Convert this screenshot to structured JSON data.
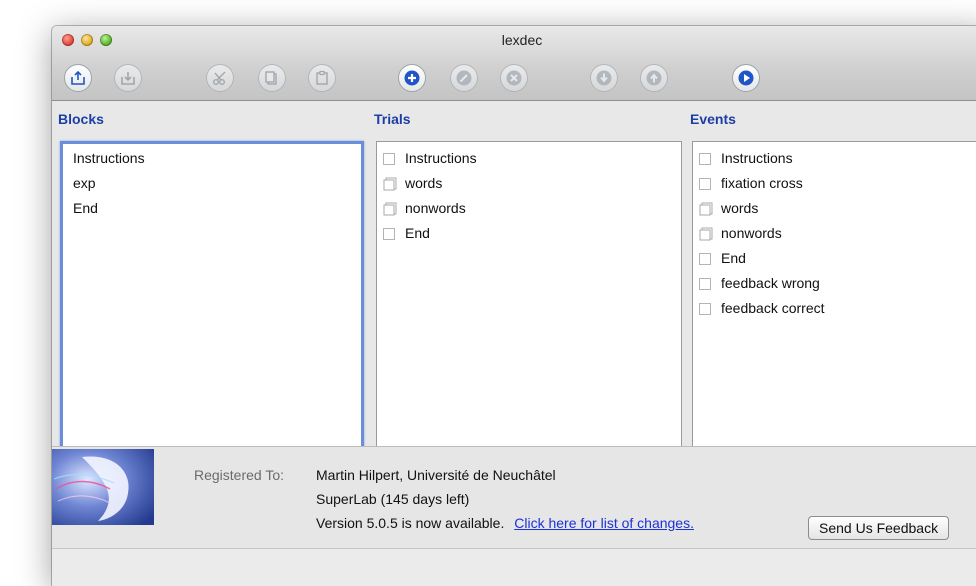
{
  "window": {
    "title": "lexdec"
  },
  "toolbar": {
    "buttons": [
      {
        "icon": "open-icon",
        "enabled": true
      },
      {
        "icon": "save-icon",
        "enabled": false
      },
      {
        "icon": "cut-icon",
        "enabled": false
      },
      {
        "icon": "copy-icon",
        "enabled": false
      },
      {
        "icon": "paste-icon",
        "enabled": false
      },
      {
        "icon": "add-icon",
        "enabled": true
      },
      {
        "icon": "edit-icon",
        "enabled": false
      },
      {
        "icon": "delete-icon",
        "enabled": false
      },
      {
        "icon": "move-down-icon",
        "enabled": false
      },
      {
        "icon": "move-up-icon",
        "enabled": false
      },
      {
        "icon": "run-icon",
        "enabled": true
      }
    ],
    "accent_color": "#1f55c9"
  },
  "blocks": {
    "label": "Blocks",
    "items": [
      "Instructions",
      "exp",
      "End"
    ]
  },
  "trials": {
    "label": "Trials",
    "items": [
      {
        "label": "Instructions",
        "icon": "checkbox-icon"
      },
      {
        "label": "words",
        "icon": "document-stack-icon"
      },
      {
        "label": "nonwords",
        "icon": "document-stack-icon"
      },
      {
        "label": "End",
        "icon": "checkbox-icon"
      }
    ]
  },
  "events": {
    "label": "Events",
    "items": [
      {
        "label": "Instructions",
        "icon": "checkbox-icon"
      },
      {
        "label": "fixation cross",
        "icon": "checkbox-icon"
      },
      {
        "label": "words",
        "icon": "document-stack-icon"
      },
      {
        "label": "nonwords",
        "icon": "document-stack-icon"
      },
      {
        "label": "End",
        "icon": "checkbox-icon"
      },
      {
        "label": "feedback wrong",
        "icon": "checkbox-icon"
      },
      {
        "label": "feedback correct",
        "icon": "checkbox-icon"
      }
    ]
  },
  "footer": {
    "registered_label": "Registered To:",
    "registered_name": "Martin Hilpert,  Université de Neuchâtel",
    "license": "SuperLab (145 days left)",
    "update_text": "Version 5.0.5 is now available.",
    "update_link": "Click here for list of changes.",
    "feedback_button": "Send Us Feedback"
  }
}
